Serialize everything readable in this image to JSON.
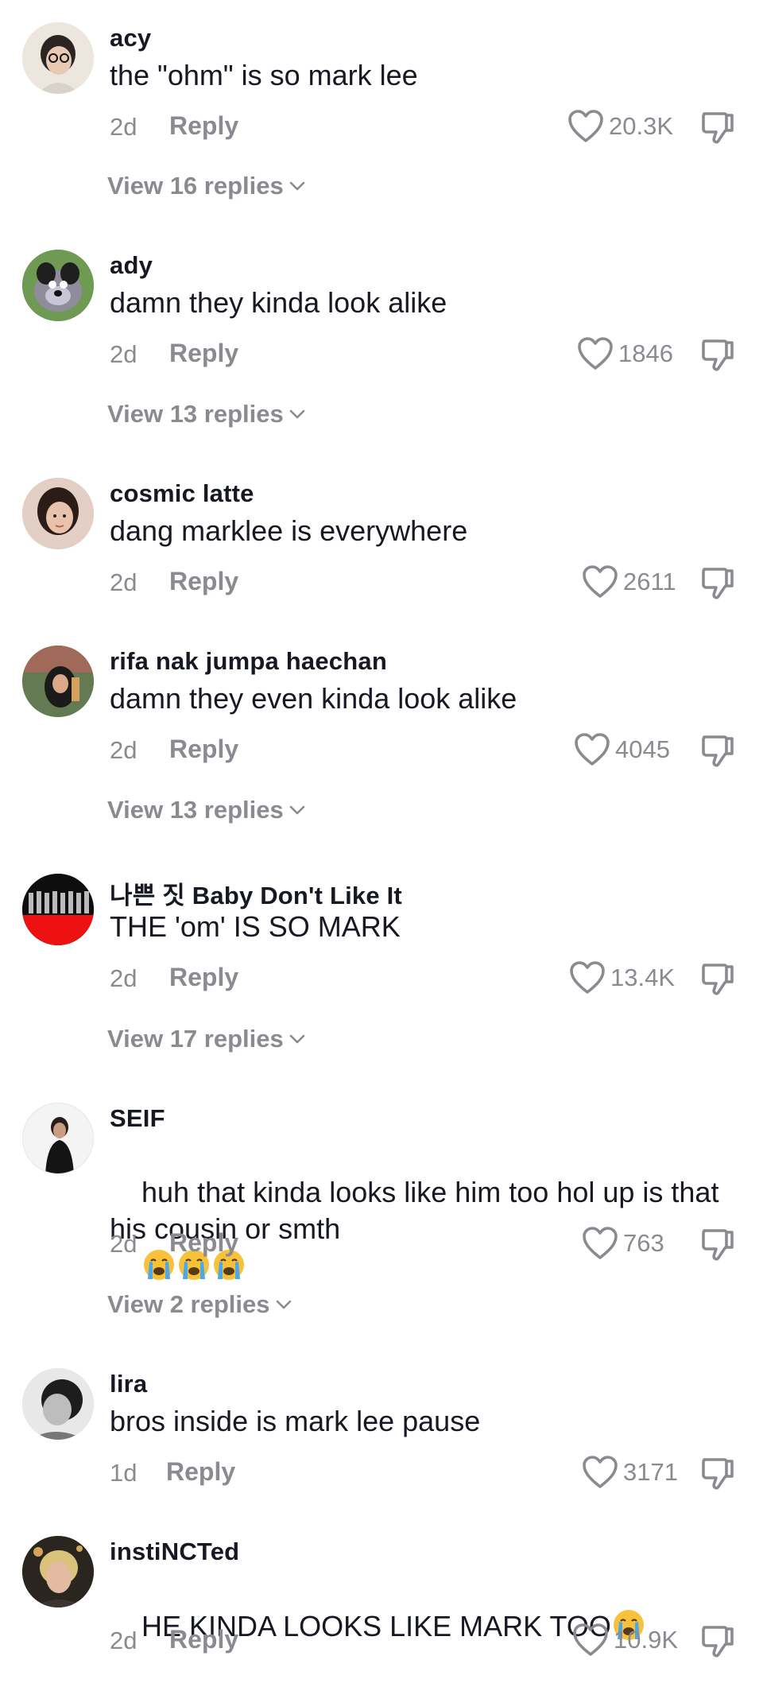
{
  "colors": {
    "text": "#161823",
    "secondary": "#8a8b91"
  },
  "comments": [
    {
      "username": "acy",
      "text": "the \"ohm\" is so mark lee",
      "time": "2d",
      "reply_label": "Reply",
      "likes": "20.3K",
      "view_replies": "View 16 replies",
      "avatar_icon": "avatar-person-glasses"
    },
    {
      "username": "ady",
      "text": "damn they kinda look alike",
      "time": "2d",
      "reply_label": "Reply",
      "likes": "1846",
      "view_replies": "View 13 replies",
      "avatar_icon": "avatar-cartoon-dog"
    },
    {
      "username": "cosmic latte",
      "text": "dang marklee is everywhere",
      "time": "2d",
      "reply_label": "Reply",
      "likes": "2611",
      "avatar_icon": "avatar-person"
    },
    {
      "username": "rifa nak jumpa haechan",
      "text": "damn they even kinda look alike",
      "time": "2d",
      "reply_label": "Reply",
      "likes": "4045",
      "view_replies": "View 13 replies",
      "avatar_icon": "avatar-person-hijab"
    },
    {
      "username": "나쁜 짓 Baby Don't Like It",
      "text": "THE 'om' IS SO MARK",
      "time": "2d",
      "reply_label": "Reply",
      "likes": "13.4K",
      "view_replies": "View 17 replies",
      "avatar_icon": "avatar-group-red"
    },
    {
      "username": "SEIF",
      "text": "huh that kinda looks like him too hol up is that his cousin or smth",
      "time": "2d",
      "reply_label": "Reply",
      "likes": "763",
      "view_replies": "View 2 replies",
      "avatar_icon": "avatar-person-dark"
    },
    {
      "username": "lira",
      "text": "bros inside is mark lee pause",
      "time": "1d",
      "reply_label": "Reply",
      "likes": "3171",
      "avatar_icon": "avatar-person-bw"
    },
    {
      "username": "instiNCTed",
      "text": "HE KINDA LOOKS LIKE MARK TOO",
      "time": "2d",
      "reply_label": "Reply",
      "likes": "10.9K",
      "avatar_icon": "avatar-person-blond"
    }
  ]
}
